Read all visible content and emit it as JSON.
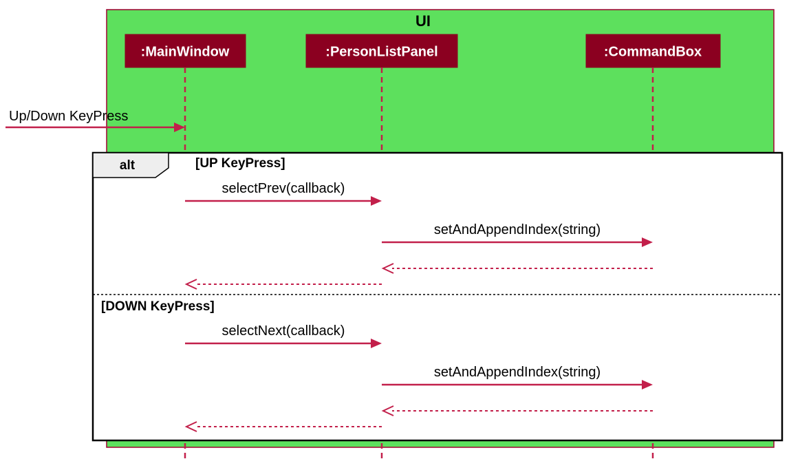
{
  "container": {
    "title": "UI"
  },
  "lifelines": {
    "mw": ":MainWindow",
    "plp": ":PersonListPanel",
    "cb": ":CommandBox"
  },
  "foundMessage": "Up/Down KeyPress",
  "altLabel": "alt",
  "guards": {
    "up": "[UP KeyPress]",
    "down": "[DOWN KeyPress]"
  },
  "messages": {
    "selectPrev": "selectPrev(callback)",
    "selectNext": "selectNext(callback)",
    "setAppend1": "setAndAppendIndex(string)",
    "setAppend2": "setAndAppendIndex(string)"
  }
}
